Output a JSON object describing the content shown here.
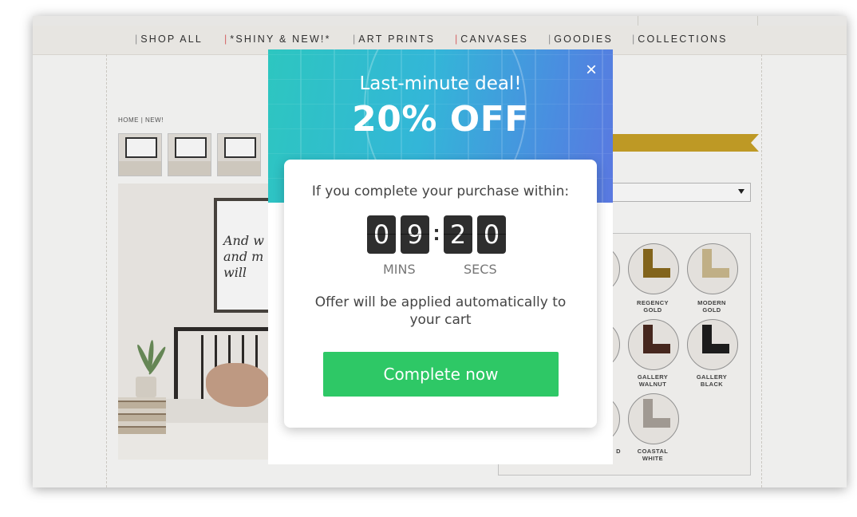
{
  "nav": {
    "items": [
      {
        "label": "SHOP ALL",
        "bar": "|"
      },
      {
        "label": "*SHINY & NEW!*",
        "bar": "|"
      },
      {
        "label": "ART PRINTS",
        "bar": "|"
      },
      {
        "label": "CANVASES",
        "bar": "|"
      },
      {
        "label": "GOODIES",
        "bar": "|"
      },
      {
        "label": "COLLECTIONS",
        "bar": "|"
      }
    ]
  },
  "breadcrumb": "HOME | NEW!",
  "hero": {
    "script_text": "And w\nand m\nwill"
  },
  "frames": [
    {
      "label": "REGENCY\nGOLD",
      "color": "#8a6a1e"
    },
    {
      "label": "MODERN\nGOLD",
      "color": "#cbb98e"
    },
    {
      "label": "GALLERY\nWALNUT",
      "color": "#4a2a20"
    },
    {
      "label": "GALLERY\nBLACK",
      "color": "#1e1e1e"
    },
    {
      "label": "COASTAL\nWHITE",
      "color": "#a9a29a"
    }
  ],
  "frames_partial": {
    "label_fragment": "D"
  },
  "modal": {
    "close_label": "×",
    "subtitle": "Last-minute deal!",
    "title": "20% OFF",
    "lead": "If you complete your purchase within:",
    "timer": {
      "d1": "0",
      "d2": "9",
      "separator": ":",
      "d3": "2",
      "d4": "0"
    },
    "units": {
      "mins": "MINS",
      "secs": "SECS"
    },
    "note": "Offer will be applied automatically to your cart",
    "cta_label": "Complete now"
  },
  "colors": {
    "cta": "#2ec866",
    "header_start": "#2dc6c0",
    "header_end": "#5a78e0",
    "ribbon": "#c9a227"
  }
}
